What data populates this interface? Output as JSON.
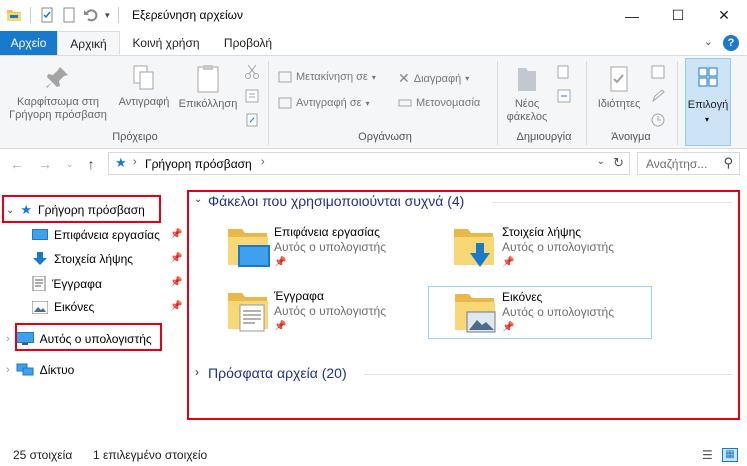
{
  "window": {
    "title": "Εξερεύνηση αρχείων",
    "minimize_glyph": "—",
    "maximize_glyph": "☐",
    "close_glyph": "✕"
  },
  "tabs": {
    "file": "Αρχείο",
    "items": [
      "Αρχική",
      "Κοινή χρήση",
      "Προβολή"
    ],
    "active": "Αρχική"
  },
  "ribbon": {
    "pin_quick": "Καρφίτσωμα στη Γρήγορη πρόσβαση",
    "copy": "Αντιγραφή",
    "paste": "Επικόλληση",
    "group_clipboard": "Πρόχειρο",
    "move_to": "Μετακίνηση σε",
    "copy_to": "Αντιγραφή σε",
    "delete": "Διαγραφή",
    "rename": "Μετονομασία",
    "group_organize": "Οργάνωση",
    "new_folder": "Νέος φάκελος",
    "group_new": "Δημιουργία",
    "properties": "Ιδιότητες",
    "group_open": "Άνοιγμα",
    "select": "Επιλογή"
  },
  "address": {
    "path": "Γρήγορη πρόσβαση",
    "search_placeholder": "Αναζήτησ..."
  },
  "nav": {
    "quick_access": "Γρήγορη πρόσβαση",
    "quick_items": [
      "Επιφάνεια εργασίας",
      "Στοιχεία λήψης",
      "Έγγραφα",
      "Εικόνες"
    ],
    "this_pc": "Αυτός ο υπολογιστής",
    "network": "Δίκτυο"
  },
  "content": {
    "frequent_title": "Φάκελοι που χρησιμοποιούνται συχνά (4)",
    "recent_title": "Πρόσφατα αρχεία (20)",
    "folders": [
      {
        "name": "Επιφάνεια εργασίας",
        "location": "Αυτός ο υπολογιστής",
        "icon": "desktop-folder"
      },
      {
        "name": "Στοιχεία λήψης",
        "location": "Αυτός ο υπολογιστής",
        "icon": "downloads-folder"
      },
      {
        "name": "Έγγραφα",
        "location": "Αυτός ο υπολογιστής",
        "icon": "documents-folder"
      },
      {
        "name": "Εικόνες",
        "location": "Αυτός ο υπολογιστής",
        "icon": "pictures-folder"
      }
    ]
  },
  "status": {
    "item_count": "25 στοιχεία",
    "selected": "1 επιλεγμένο στοιχείο"
  },
  "colors": {
    "accent": "#1979ca",
    "highlight_box": "#e30016",
    "group_title": "#1e3287"
  }
}
